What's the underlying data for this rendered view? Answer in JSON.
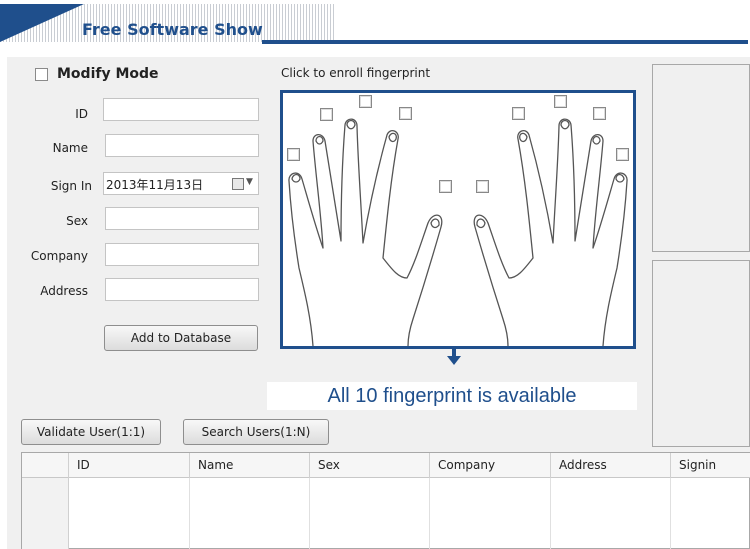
{
  "header": {
    "title": "Free Software Show"
  },
  "form": {
    "modify_label": "Modify Mode",
    "id_label": "ID",
    "name_label": "Name",
    "signin_label": "Sign In",
    "signin_value": "2013年11月13日",
    "sex_label": "Sex",
    "company_label": "Company",
    "address_label": "Address",
    "add_button": "Add to Database"
  },
  "enroll": {
    "title": "Click to enroll fingerprint",
    "banner": "All 10 fingerprint is available"
  },
  "actions": {
    "validate_button": "Validate User(1:1)",
    "search_button": "Search Users(1:N)"
  },
  "table": {
    "columns": [
      "ID",
      "Name",
      "Sex",
      "Company",
      "Address",
      "Signin"
    ]
  },
  "colors": {
    "accent": "#1f4f8c"
  }
}
